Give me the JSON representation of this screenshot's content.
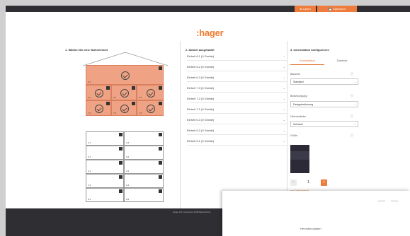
{
  "topbar": {
    "button1": "⬇ Laden",
    "button2": "💾 Speichern"
  },
  "logo": ":hager",
  "sections": {
    "left_title": "1. Wählen Sie eine Wohneinheit",
    "middle_title": "2. Aktuell ausgewählt",
    "right_title": "3. Innenstation konfigurieren"
  },
  "house": {
    "cells": [
      {
        "label": "6.1",
        "selected": true
      },
      {
        "label": "5.1",
        "selected": true
      },
      {
        "label": "5.2",
        "selected": true
      },
      {
        "label": "5.3",
        "selected": true
      },
      {
        "label": "7.1",
        "selected": true
      },
      {
        "label": "7.2",
        "selected": true
      },
      {
        "label": "7.3",
        "selected": true
      },
      {
        "label": "4.1",
        "selected": false
      },
      {
        "label": "4.2",
        "selected": false
      },
      {
        "label": "3.1",
        "selected": false
      },
      {
        "label": "3.2",
        "selected": false
      },
      {
        "label": "2.1",
        "selected": false
      },
      {
        "label": "2.2",
        "selected": false
      },
      {
        "label": "1.1",
        "selected": false
      },
      {
        "label": "1.2",
        "selected": false
      },
      {
        "label": "0.1",
        "selected": false
      },
      {
        "label": "0.2",
        "selected": false
      },
      {
        "label": "-1.1",
        "selected": false
      },
      {
        "label": "-1.2",
        "selected": false
      }
    ]
  },
  "selected_list": [
    "Einheit 6.1 (0 Geräte)",
    "Einheit 6.2 (0 Geräte)",
    "Einheit 6.3 (0 Geräte)",
    "Einheit 7.3 (0 Geräte)",
    "Einheit 7.2 (0 Geräte)",
    "Einheit 7.1 (0 Geräte)",
    "Einheit 5.3 (0 Geräte)",
    "Einheit 5.2 (0 Geräte)",
    "Einheit 5.1 (0 Geräte)"
  ],
  "config": {
    "tab_active": "Innenstation",
    "tab_other": "Zubehör",
    "field1_label": "Bauserie",
    "field1_value": "Standard",
    "field2_label": "Bedienungstyp",
    "field2_value": "Designbedienung",
    "field3_label": "Hörerlosfarbe",
    "field3_value": "Schwarz",
    "field4_label": "Größe",
    "quantity": "1",
    "qty_minus": "−",
    "qty_plus": "+",
    "merkzettel_link": "pro Wohneinheit",
    "info_icon": "info-icon"
  },
  "footer": {
    "links": "Hager AG   Impressum   AGB   Datenschutz"
  },
  "overlay": {
    "title": "Herunterzuladen"
  },
  "colors": {
    "accent": "#ee7c3d",
    "selected_cell": "#efa384",
    "dark_bar": "#2f2f33"
  }
}
